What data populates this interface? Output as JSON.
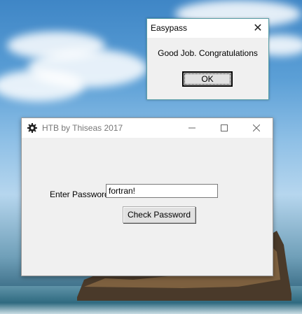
{
  "desktop": {
    "wallpaper": "sky-and-sea-rock"
  },
  "dialog": {
    "title": "Easypass",
    "message": "Good Job. Congratulations",
    "ok_label": "OK",
    "close_glyph": "✕"
  },
  "window": {
    "title": "HTB by Thiseas 2017",
    "minimize_glyph": "—",
    "maximize_glyph": "☐",
    "close_glyph": "✕",
    "password_label": "Enter Password",
    "password_value": "fortran!",
    "check_button_label": "Check Password"
  },
  "colors": {
    "dialog_border": "#5aa0a8",
    "button_face": "#e1e1e1",
    "window_bg": "#f0f0f0"
  }
}
